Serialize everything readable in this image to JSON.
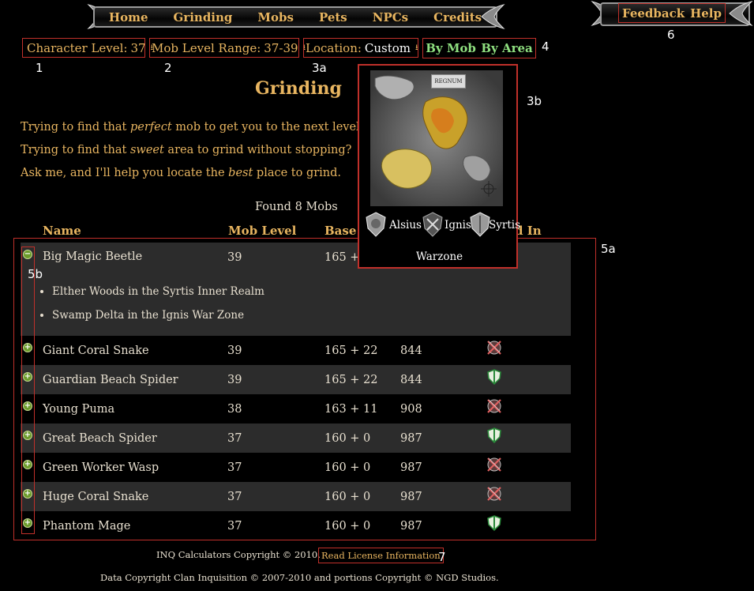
{
  "nav": {
    "items": [
      "Home",
      "Grinding",
      "Mobs",
      "Pets",
      "NPCs",
      "Credits"
    ]
  },
  "top_right": {
    "feedback": "Feedback",
    "help": "Help"
  },
  "controls": {
    "char_level_label": "Character Level:",
    "char_level_value": "37",
    "mob_range_label": "Mob Level Range:",
    "mob_range_value": "37-39",
    "location_label": "Location:",
    "location_value": "Custom",
    "by_mob": "By Mob",
    "by_area": "By Area"
  },
  "annotations": {
    "a1": "1",
    "a2": "2",
    "a3a": "3a",
    "a3b": "3b",
    "a4": "4",
    "a5a": "5a",
    "a5b": "5b",
    "a6": "6",
    "a7": "7"
  },
  "page_title": "Grinding",
  "intro": {
    "line1_pre": "Trying to find that ",
    "line1_em": "perfect",
    "line1_post": " mob to get you to the next level?",
    "line2_pre": "Trying to find that ",
    "line2_em": "sweet",
    "line2_post": " area to grind without stopping?",
    "line3_pre": "Ask me, and I'll help you locate the ",
    "line3_em": "best",
    "line3_post": " place to grind."
  },
  "found_text": "Found 8 Mobs",
  "table": {
    "headers": {
      "name": "Name",
      "level": "Mob Level",
      "base": "Base",
      "found_in": "d In"
    },
    "expanded_locations": [
      "Elther Woods in the Syrtis Inner Realm",
      "Swamp Delta in the Ignis War Zone"
    ],
    "rows": [
      {
        "name": "Big Magic Beetle",
        "level": "39",
        "xp": "165 +",
        "kills": "",
        "icon": ""
      },
      {
        "name": "Giant Coral Snake",
        "level": "39",
        "xp": "165 + 22",
        "kills": "844",
        "icon": "crossed-swords-icon"
      },
      {
        "name": "Guardian Beach Spider",
        "level": "39",
        "xp": "165 + 22",
        "kills": "844",
        "icon": "shield-icon"
      },
      {
        "name": "Young Puma",
        "level": "38",
        "xp": "163 + 11",
        "kills": "908",
        "icon": "crossed-swords-icon"
      },
      {
        "name": "Great Beach Spider",
        "level": "37",
        "xp": "160 + 0",
        "kills": "987",
        "icon": "shield-icon"
      },
      {
        "name": "Green Worker Wasp",
        "level": "37",
        "xp": "160 + 0",
        "kills": "987",
        "icon": "crossed-swords-icon"
      },
      {
        "name": "Huge Coral Snake",
        "level": "37",
        "xp": "160 + 0",
        "kills": "987",
        "icon": "crossed-swords-icon"
      },
      {
        "name": "Phantom Mage",
        "level": "37",
        "xp": "160 + 0",
        "kills": "987",
        "icon": "shield-icon"
      }
    ]
  },
  "map_popup": {
    "logo": "REGNUM",
    "realms": [
      "Alsius",
      "Ignis",
      "Syrtis"
    ],
    "warzone": "Warzone"
  },
  "footer": {
    "copyright": "INQ Calculators Copyright © 2010.",
    "license_link": "Read License Information",
    "data_copyright": "Data Copyright Clan Inquisition © 2007-2010 and portions Copyright © NGD Studios."
  },
  "colors": {
    "gold": "#e8b560",
    "green_button": "#8fe080",
    "annotation_red": "#c0302a",
    "row_dark": "#2c2c2c"
  }
}
